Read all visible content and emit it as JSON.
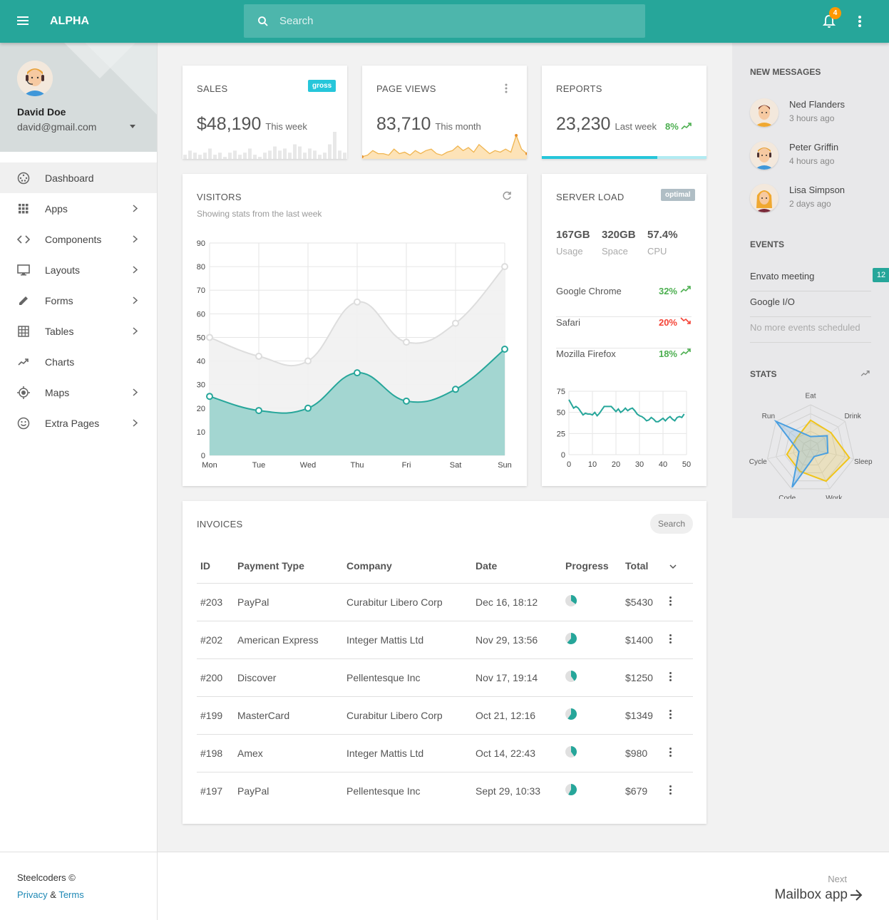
{
  "topbar": {
    "brand": "ALPHA",
    "search_placeholder": "Search",
    "notification_count": "4"
  },
  "profile": {
    "name": "David Doe",
    "email": "david@gmail.com"
  },
  "sidebar": {
    "items": [
      {
        "label": "Dashboard",
        "icon": "dashboard-icon",
        "active": true,
        "submenu": false
      },
      {
        "label": "Apps",
        "icon": "apps-grid-icon",
        "submenu": true
      },
      {
        "label": "Components",
        "icon": "code-icon",
        "submenu": true
      },
      {
        "label": "Layouts",
        "icon": "monitor-icon",
        "submenu": true
      },
      {
        "label": "Forms",
        "icon": "pencil-icon",
        "submenu": true
      },
      {
        "label": "Tables",
        "icon": "table-icon",
        "submenu": true
      },
      {
        "label": "Charts",
        "icon": "trending-up-icon",
        "submenu": false
      },
      {
        "label": "Maps",
        "icon": "location-icon",
        "submenu": true
      },
      {
        "label": "Extra Pages",
        "icon": "smiley-icon",
        "submenu": true
      }
    ],
    "footer": {
      "copyright": "Steelcoders ©",
      "privacy": "Privacy",
      "amp": "&",
      "terms": "Terms"
    }
  },
  "cards": {
    "sales": {
      "title": "SALES",
      "badge": "gross",
      "value": "$48,190",
      "period": "This week",
      "spark": [
        2,
        4,
        3,
        2,
        3,
        5,
        2,
        3,
        1,
        3,
        4,
        2,
        3,
        5,
        2,
        1,
        3,
        4,
        6,
        4,
        5,
        3,
        7,
        6,
        3,
        5,
        4,
        2,
        3,
        7,
        13,
        4,
        3
      ]
    },
    "pageviews": {
      "title": "PAGE VIEWS",
      "value": "83,710",
      "period": "This month",
      "spark": [
        1,
        2,
        5,
        3,
        3,
        2,
        6,
        3,
        4,
        2,
        5,
        3,
        5,
        6,
        3,
        2,
        4,
        5,
        8,
        5,
        7,
        4,
        9,
        6,
        3,
        5,
        4,
        6,
        4,
        15,
        6,
        3
      ]
    },
    "reports": {
      "title": "REPORTS",
      "value": "23,230",
      "period": "Last week",
      "change": "8%",
      "progress": 0.7
    }
  },
  "visitors": {
    "title": "VISITORS",
    "subtitle": "Showing stats from the last week"
  },
  "server": {
    "title": "SERVER LOAD",
    "badge": "optimal",
    "stats": [
      {
        "value": "167GB",
        "label": "Usage"
      },
      {
        "value": "320GB",
        "label": "Space"
      },
      {
        "value": "57.4%",
        "label": "CPU"
      }
    ],
    "browsers": [
      {
        "name": "Google Chrome",
        "pct": "32%",
        "trend": "up"
      },
      {
        "name": "Safari",
        "pct": "20%",
        "trend": "down"
      },
      {
        "name": "Mozilla Firefox",
        "pct": "18%",
        "trend": "up"
      }
    ]
  },
  "invoices": {
    "title": "INVOICES",
    "search_placeholder": "Search",
    "columns": [
      "ID",
      "Payment Type",
      "Company",
      "Date",
      "Progress",
      "Total"
    ],
    "rows": [
      {
        "id": "#203",
        "type": "PayPal",
        "company": "Curabitur Libero Corp",
        "date": "Dec 16, 18:12",
        "progress": 0.35,
        "total": "$5430"
      },
      {
        "id": "#202",
        "type": "American Express",
        "company": "Integer Mattis Ltd",
        "date": "Nov 29, 13:56",
        "progress": 0.62,
        "total": "$1400"
      },
      {
        "id": "#200",
        "type": "Discover",
        "company": "Pellentesque Inc",
        "date": "Nov 17, 19:14",
        "progress": 0.4,
        "total": "$1250"
      },
      {
        "id": "#199",
        "type": "MasterCard",
        "company": "Curabitur Libero Corp",
        "date": "Oct 21, 12:16",
        "progress": 0.6,
        "total": "$1349"
      },
      {
        "id": "#198",
        "type": "Amex",
        "company": "Integer Mattis Ltd",
        "date": "Oct 14, 22:43",
        "progress": 0.4,
        "total": "$980"
      },
      {
        "id": "#197",
        "type": "PayPal",
        "company": "Pellentesque Inc",
        "date": "Sept 29, 10:33",
        "progress": 0.58,
        "total": "$679"
      }
    ]
  },
  "rightpanel": {
    "messages_title": "NEW MESSAGES",
    "messages": [
      {
        "name": "Ned Flanders",
        "time": "3 hours ago"
      },
      {
        "name": "Peter Griffin",
        "time": "4 hours ago"
      },
      {
        "name": "Lisa Simpson",
        "time": "2 days ago"
      }
    ],
    "events_title": "EVENTS",
    "events": [
      {
        "name": "Envato meeting",
        "count": "12"
      },
      {
        "name": "Google I/O"
      },
      {
        "name": "No more events scheduled"
      }
    ],
    "stats_title": "STATS"
  },
  "footer": {
    "next_label": "Next",
    "next_title": "Mailbox app"
  },
  "colors": {
    "primary": "#26a69a",
    "accent": "#ff9800",
    "up": "#4caf50",
    "down": "#f44336",
    "cyan": "#26c6da"
  },
  "chart_data": [
    {
      "type": "area",
      "title": "VISITORS",
      "categories": [
        "Mon",
        "Tue",
        "Wed",
        "Thu",
        "Fri",
        "Sat",
        "Sun"
      ],
      "series": [
        {
          "name": "series-1",
          "values": [
            50,
            42,
            40,
            65,
            48,
            56,
            80
          ],
          "color": "#dddddd"
        },
        {
          "name": "series-2",
          "values": [
            25,
            19,
            20,
            35,
            23,
            28,
            45
          ],
          "color": "#26a69a"
        }
      ],
      "ylim": [
        0,
        90
      ],
      "yticks": [
        0,
        10,
        20,
        30,
        40,
        50,
        60,
        70,
        80,
        90
      ],
      "grid": true
    },
    {
      "type": "line",
      "title": "SERVER LOAD",
      "x": [
        0,
        1,
        2,
        3,
        4,
        5,
        6,
        7,
        8,
        9,
        10,
        11,
        12,
        13,
        14,
        15,
        16,
        17,
        18,
        19,
        20,
        21,
        22,
        23,
        24,
        25,
        26,
        27,
        28,
        29,
        30,
        31,
        32,
        33,
        34,
        35,
        36,
        37,
        38,
        39,
        40,
        41,
        42,
        43,
        44,
        45,
        46,
        47,
        48,
        49
      ],
      "values": [
        65,
        60,
        55,
        57,
        55,
        51,
        47,
        49,
        48,
        48,
        47,
        50,
        46,
        49,
        53,
        57,
        57,
        57,
        57,
        54,
        51,
        54,
        50,
        52,
        55,
        52,
        54,
        55,
        52,
        48,
        46,
        45,
        43,
        40,
        41,
        44,
        42,
        39,
        39,
        41,
        43,
        40,
        43,
        45,
        42,
        40,
        44,
        45,
        44,
        48
      ],
      "xlim": [
        0,
        50
      ],
      "ylim": [
        0,
        75
      ],
      "xticks": [
        0,
        10,
        20,
        30,
        40,
        50
      ],
      "yticks": [
        0,
        25,
        50,
        75
      ],
      "grid": true
    },
    {
      "type": "radar",
      "title": "STATS",
      "categories": [
        "Eat",
        "Drink",
        "Sleep",
        "Work",
        "Code",
        "Cycle",
        "Run"
      ],
      "series": [
        {
          "name": "series-1",
          "values": [
            65,
            59,
            90,
            81,
            56,
            55,
            40
          ],
          "color": "#f0c419"
        },
        {
          "name": "series-2",
          "values": [
            28,
            48,
            40,
            19,
            96,
            27,
            100
          ],
          "color": "#4a9fe0"
        }
      ],
      "rlim": [
        0,
        100
      ]
    }
  ]
}
